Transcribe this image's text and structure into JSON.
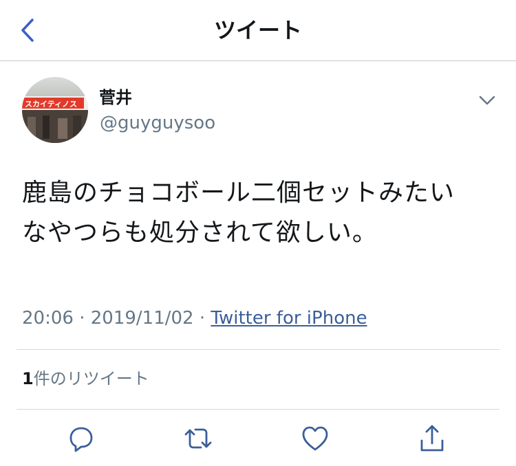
{
  "header": {
    "title": "ツイート",
    "back_icon": "chevron-left-icon",
    "accent_color": "#3b5ec8"
  },
  "tweet": {
    "display_name": "菅井",
    "handle": "@guyguysoo",
    "avatar_sign_text": "スカイティノス",
    "text": "鹿島のチョコボール二個セットみたい\nなやつらも処分されて欲しい。",
    "time": "20:06",
    "separator": "·",
    "date": "2019/11/02",
    "source": "Twitter for iPhone",
    "link_color": "#3b5e9a"
  },
  "stats": {
    "retweet_count": "1",
    "retweet_label": "件のリツイート"
  },
  "actions": {
    "reply_icon": "reply-icon",
    "retweet_icon": "retweet-icon",
    "like_icon": "heart-icon",
    "share_icon": "share-icon"
  }
}
